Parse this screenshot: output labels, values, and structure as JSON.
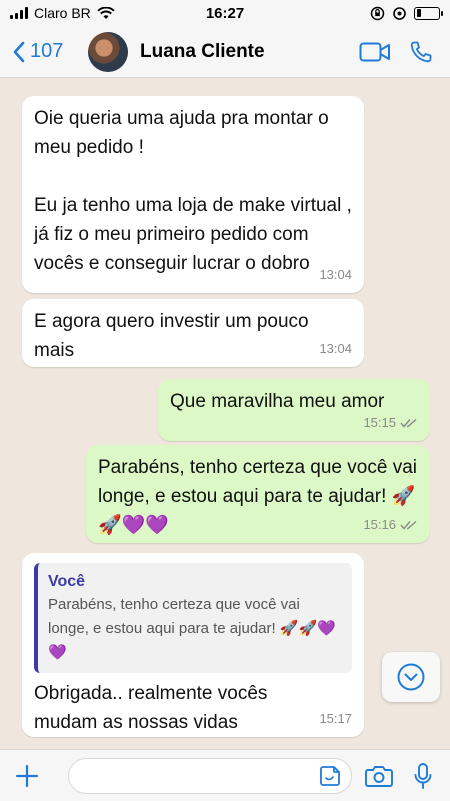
{
  "status_bar": {
    "carrier": "Claro BR",
    "time": "16:27",
    "battery_level": 0.2
  },
  "header": {
    "back_count": "107",
    "contact_name": "Luana Cliente",
    "icons": [
      "chevron-left-icon",
      "avatar",
      "video-camera-icon",
      "phone-icon"
    ]
  },
  "messages": [
    {
      "direction": "incoming",
      "text": "Oie queria uma ajuda pra montar o meu pedido !\n\nEu ja tenho uma loja de make virtual , já fiz o meu primeiro pedido com vocês e conseguir lucrar o dobro",
      "time": "13:04"
    },
    {
      "direction": "incoming",
      "text": "E agora quero investir um pouco mais",
      "time": "13:04"
    },
    {
      "direction": "outgoing",
      "text": "Que maravilha meu amor",
      "time": "15:15"
    },
    {
      "direction": "outgoing",
      "text": "Parabéns, tenho certeza que você vai longe, e estou aqui para te ajudar! 🚀🚀💜💜",
      "time": "15:16"
    },
    {
      "direction": "incoming",
      "quote_name": "Você",
      "quote_text": "Parabéns, tenho certeza que você vai longe, e estou aqui para te ajudar! 🚀🚀💜💜",
      "text": "Obrigada.. realmente vocês mudam as nossas vidas",
      "time": "15:17"
    }
  ],
  "input": {
    "placeholder": "",
    "icons": [
      "plus-icon",
      "sticker-icon",
      "camera-icon",
      "microphone-icon"
    ]
  },
  "colors": {
    "accent": "#1f7bd8",
    "outgoing_bubble": "#dcf8c6",
    "incoming_bubble": "#ffffff",
    "chat_background": "#efe7de",
    "quote_accent": "#3d3aa3"
  }
}
